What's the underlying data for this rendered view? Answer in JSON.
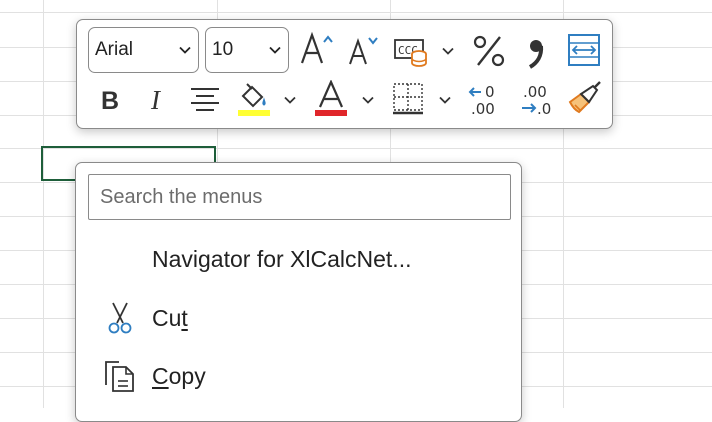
{
  "toolbar": {
    "font_name": "Arial",
    "font_size": "10",
    "colors": {
      "highlight": "#ffff33",
      "font_color": "#e0262a",
      "accent": "#2f7ec1",
      "orange": "#e07a1f"
    }
  },
  "menu": {
    "search_placeholder": "Search the menus",
    "items": [
      {
        "label": "Navigator for XlCalcNet...",
        "icon": null
      },
      {
        "label_pre": "Cu",
        "label_ul": "t",
        "label_post": "",
        "icon": "scissors-icon"
      },
      {
        "label_pre": "",
        "label_ul": "C",
        "label_post": "opy",
        "icon": "copy-icon"
      }
    ]
  }
}
